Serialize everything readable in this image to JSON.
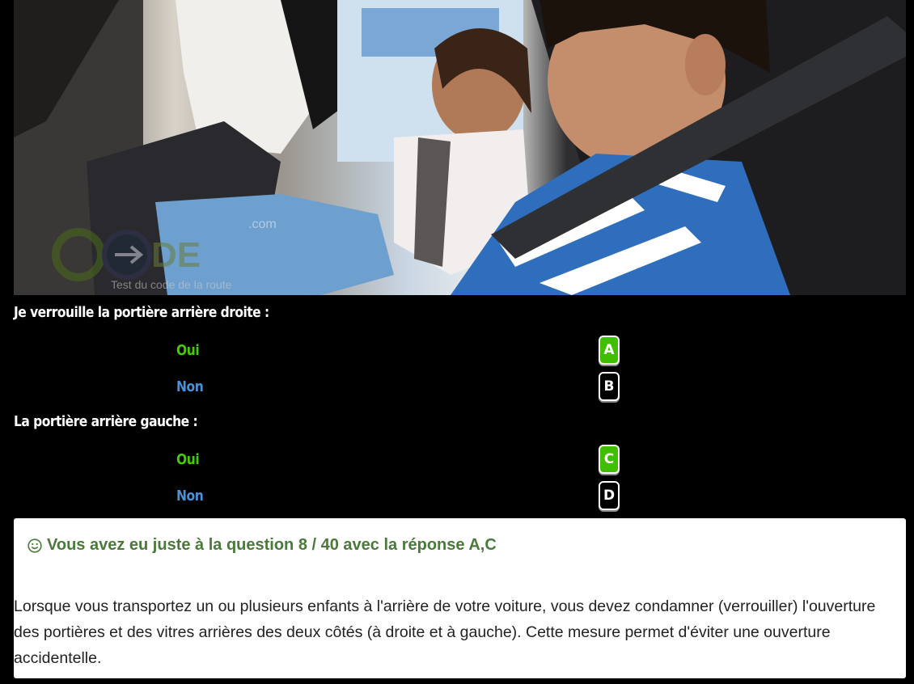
{
  "photo": {
    "watermark_text": "CODE",
    "watermark_sub": "Test du code de la route",
    "watermark_domain": ".com"
  },
  "questions": [
    {
      "text": "Je verrouille la portière arrière droite :",
      "answers": [
        {
          "label": "Oui",
          "letter": "A",
          "selected": true
        },
        {
          "label": "Non",
          "letter": "B",
          "selected": false
        }
      ]
    },
    {
      "text": "La portière arrière gauche :",
      "answers": [
        {
          "label": "Oui",
          "letter": "C",
          "selected": true
        },
        {
          "label": "Non",
          "letter": "D",
          "selected": false
        }
      ]
    }
  ],
  "result": {
    "title": "Vous avez eu juste à la question 8 / 40 avec la réponse A,C",
    "explanation": "Lorsque vous transportez un ou plusieurs enfants à l'arrière de votre voiture, vous devez condamner (verrouiller) l'ouverture des portières et des vitres arrières des deux côtés (à droite et à gauche). Cette mesure permet d'éviter une ouverture accidentelle."
  },
  "colors": {
    "oui": "#44cc00",
    "non": "#4a8fd8",
    "selected_button": "#3fbf00",
    "result_title": "#4a7a3a"
  }
}
